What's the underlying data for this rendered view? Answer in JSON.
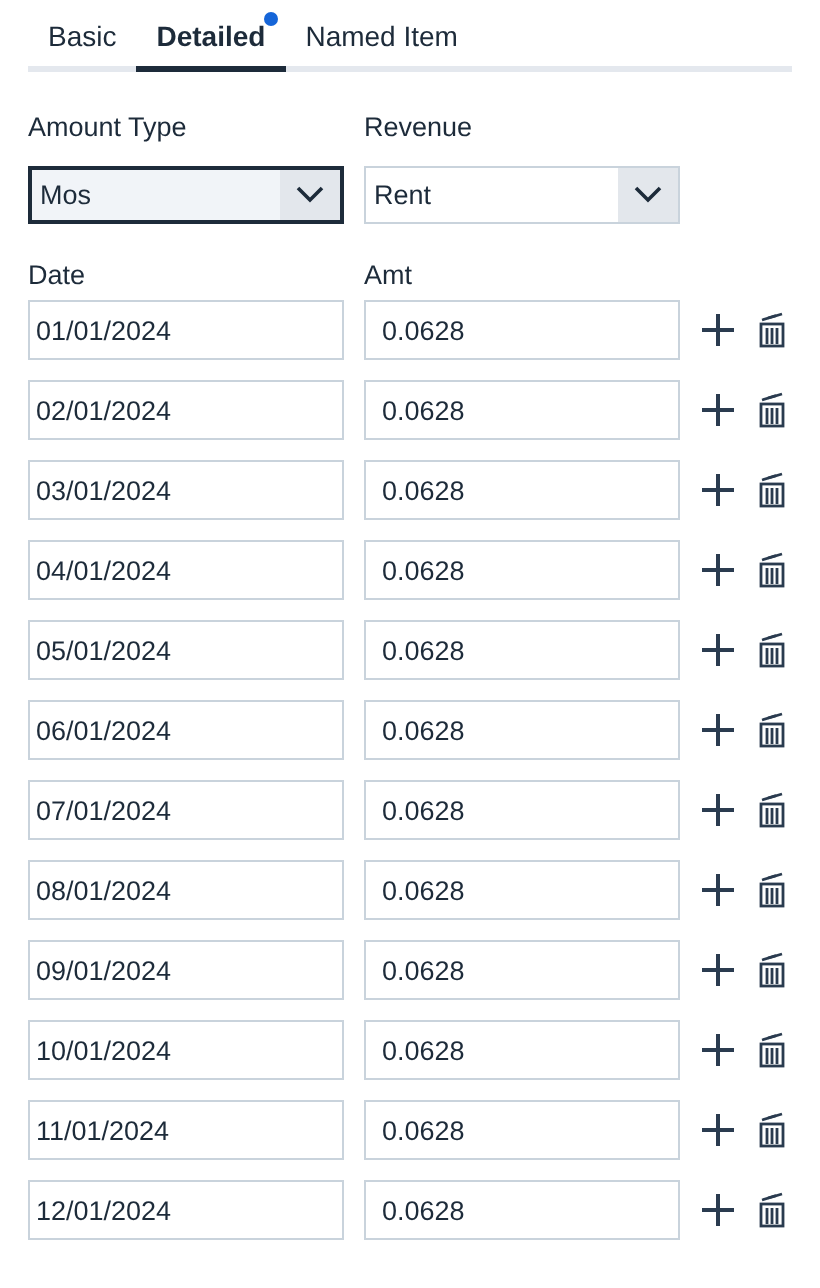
{
  "tabs": [
    {
      "label": "Basic",
      "selected": false,
      "dot": false
    },
    {
      "label": "Detailed",
      "selected": true,
      "dot": true
    },
    {
      "label": "Named Item",
      "selected": false,
      "dot": false
    }
  ],
  "selects": [
    {
      "label": "Amount Type",
      "value": "Mos",
      "focused": true
    },
    {
      "label": "Revenue",
      "value": "Rent",
      "focused": false
    }
  ],
  "columns": [
    "Date",
    "Amt"
  ],
  "rows": [
    {
      "date": "01/01/2024",
      "amt": "0.0628"
    },
    {
      "date": "02/01/2024",
      "amt": "0.0628"
    },
    {
      "date": "03/01/2024",
      "amt": "0.0628"
    },
    {
      "date": "04/01/2024",
      "amt": "0.0628"
    },
    {
      "date": "05/01/2024",
      "amt": "0.0628"
    },
    {
      "date": "06/01/2024",
      "amt": "0.0628"
    },
    {
      "date": "07/01/2024",
      "amt": "0.0628"
    },
    {
      "date": "08/01/2024",
      "amt": "0.0628"
    },
    {
      "date": "09/01/2024",
      "amt": "0.0628"
    },
    {
      "date": "10/01/2024",
      "amt": "0.0628"
    },
    {
      "date": "11/01/2024",
      "amt": "0.0628"
    },
    {
      "date": "12/01/2024",
      "amt": "0.0628"
    }
  ]
}
